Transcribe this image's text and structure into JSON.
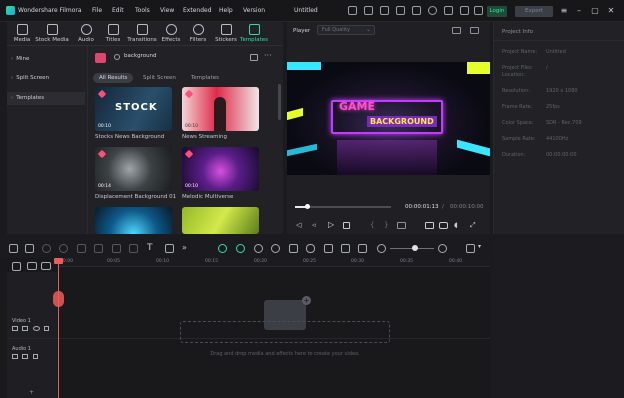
{
  "app": {
    "name": "Wondershare Filmora",
    "project": "Untitled",
    "login": "Login",
    "export": "Export"
  },
  "menu": [
    "File",
    "Edit",
    "Tools",
    "View",
    "Extended",
    "Help",
    "Version"
  ],
  "tabs": [
    {
      "label": "Media",
      "icon": "media-icon"
    },
    {
      "label": "Stock Media",
      "icon": "stock-media-icon"
    },
    {
      "label": "Audio",
      "icon": "audio-icon"
    },
    {
      "label": "Titles",
      "icon": "titles-icon"
    },
    {
      "label": "Transitions",
      "icon": "transitions-icon"
    },
    {
      "label": "Effects",
      "icon": "effects-icon"
    },
    {
      "label": "Filters",
      "icon": "filters-icon"
    },
    {
      "label": "Stickers",
      "icon": "stickers-icon"
    },
    {
      "label": "Templates",
      "icon": "templates-icon",
      "active": true
    }
  ],
  "sidebar": [
    {
      "label": "Mine",
      "selected": false
    },
    {
      "label": "Split Screen",
      "selected": false
    },
    {
      "label": "Templates",
      "selected": true
    }
  ],
  "search": {
    "value": "background"
  },
  "filters": [
    {
      "label": "All Results",
      "active": true
    },
    {
      "label": "Split Screen",
      "active": false
    },
    {
      "label": "Templates",
      "active": false
    }
  ],
  "templates": [
    {
      "title": "Stocks News Background",
      "duration": "00:10",
      "thumb_text": "STOCK"
    },
    {
      "title": "News Streaming",
      "duration": "00:10",
      "thumb_text": ""
    },
    {
      "title": "Displacement Background 01",
      "duration": "00:14",
      "thumb_text": ""
    },
    {
      "title": "Melodic Multiverse",
      "duration": "00:10",
      "thumb_text": ""
    },
    {
      "title": "",
      "duration": "",
      "thumb_text": ""
    },
    {
      "title": "",
      "duration": "",
      "thumb_text": ""
    }
  ],
  "player": {
    "label": "Player",
    "quality": "Full Quality",
    "preview_title": "GAME",
    "preview_subtitle": "BACKGROUND",
    "current_time": "00:00:01:13",
    "total_time": "00:00:10:00",
    "progress": 0.12
  },
  "project_info": {
    "title": "Project Info",
    "rows": [
      {
        "label": "Project Name:",
        "value": "Untitled"
      },
      {
        "label": "Project Files Location:",
        "value": "/"
      },
      {
        "label": "Resolution:",
        "value": "1920 x 1080"
      },
      {
        "label": "Frame Rate:",
        "value": "25fps"
      },
      {
        "label": "Color Space:",
        "value": "SDR - Rec.709"
      },
      {
        "label": "Sample Rate:",
        "value": "44100Hz"
      },
      {
        "label": "Duration:",
        "value": "00:00:00:00"
      }
    ]
  },
  "timeline": {
    "ruler": [
      "00:00",
      "00:05",
      "00:10",
      "00:15",
      "00:20",
      "00:25",
      "00:30",
      "00:35",
      "00:40"
    ],
    "tracks": [
      {
        "label": "Video 1"
      },
      {
        "label": "Audio 1"
      }
    ],
    "drop_hint": "Drag and drop media and effects here to create your video."
  }
}
